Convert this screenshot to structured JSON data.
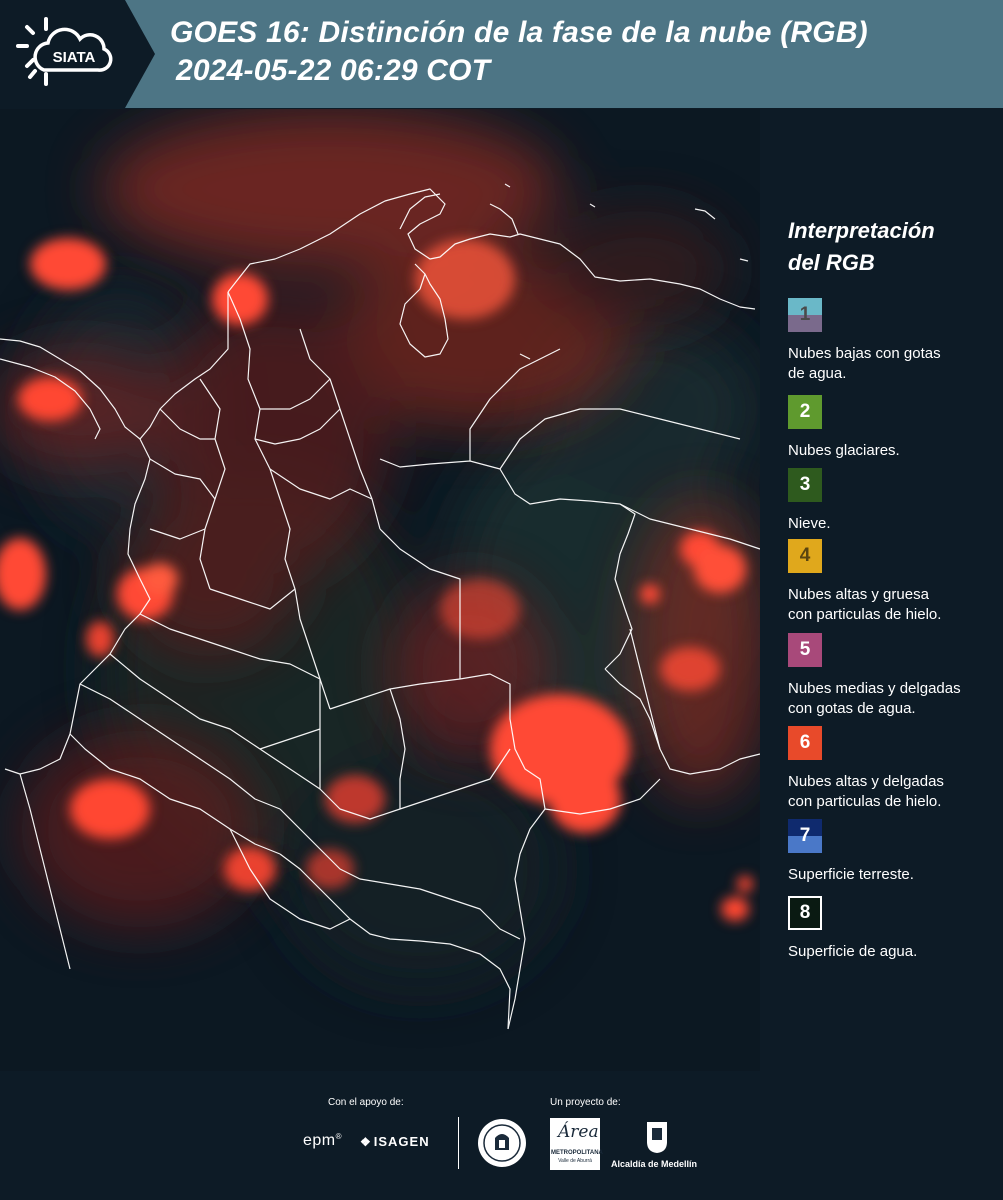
{
  "header": {
    "logo_text": "SIATA",
    "title_line1": "GOES 16: Distinción de la fase de la nube (RGB)",
    "title_line2": "2024-05-22 06:29 COT"
  },
  "legend": {
    "title_line1": "Interpretación",
    "title_line2": "del RGB",
    "items": [
      {
        "number": "1",
        "text_line1": "Nubes bajas con gotas",
        "text_line2": "de agua.",
        "color_top": "#6ab8c8",
        "color_bottom": "#7a6a8c"
      },
      {
        "number": "2",
        "text_line1": "Nubes glaciares.",
        "text_line2": "",
        "color_top": "#5f9a2e",
        "color_bottom": "#5f9a2e"
      },
      {
        "number": "3",
        "text_line1": "Nieve.",
        "text_line2": "",
        "color_top": "#2e5a1e",
        "color_bottom": "#2e5a1e"
      },
      {
        "number": "4",
        "text_line1": "Nubes altas y gruesa",
        "text_line2": "con particulas de hielo.",
        "color_top": "#e0a81c",
        "color_bottom": "#e0a81c"
      },
      {
        "number": "5",
        "text_line1": "Nubes medias y delgadas",
        "text_line2": "con gotas de agua.",
        "color_top": "#a8497a",
        "color_bottom": "#a8497a"
      },
      {
        "number": "6",
        "text_line1": "Nubes altas y delgadas",
        "text_line2": "con particulas de hielo.",
        "color_top": "#e84a2a",
        "color_bottom": "#e84a2a"
      },
      {
        "number": "7",
        "text_line1": "Superficie terreste.",
        "text_line2": "",
        "color_top": "#0f2a6e",
        "color_bottom": "#4a78c8"
      },
      {
        "number": "8",
        "text_line1": "Superficie de agua.",
        "text_line2": "",
        "color_top": "#0a1a12",
        "color_bottom": "#0a1a12"
      }
    ]
  },
  "footer": {
    "support_label": "Con el apoyo de:",
    "project_label": "Un proyecto de:",
    "sponsor_epm": "epm",
    "sponsor_isagen": "ISAGEN",
    "sponsor_area_line1": "METROPOLITANA",
    "sponsor_area_line2": "Valle de Aburrá",
    "sponsor_area_script": "Área",
    "sponsor_alcaldia": "Alcaldía de Medellín"
  }
}
